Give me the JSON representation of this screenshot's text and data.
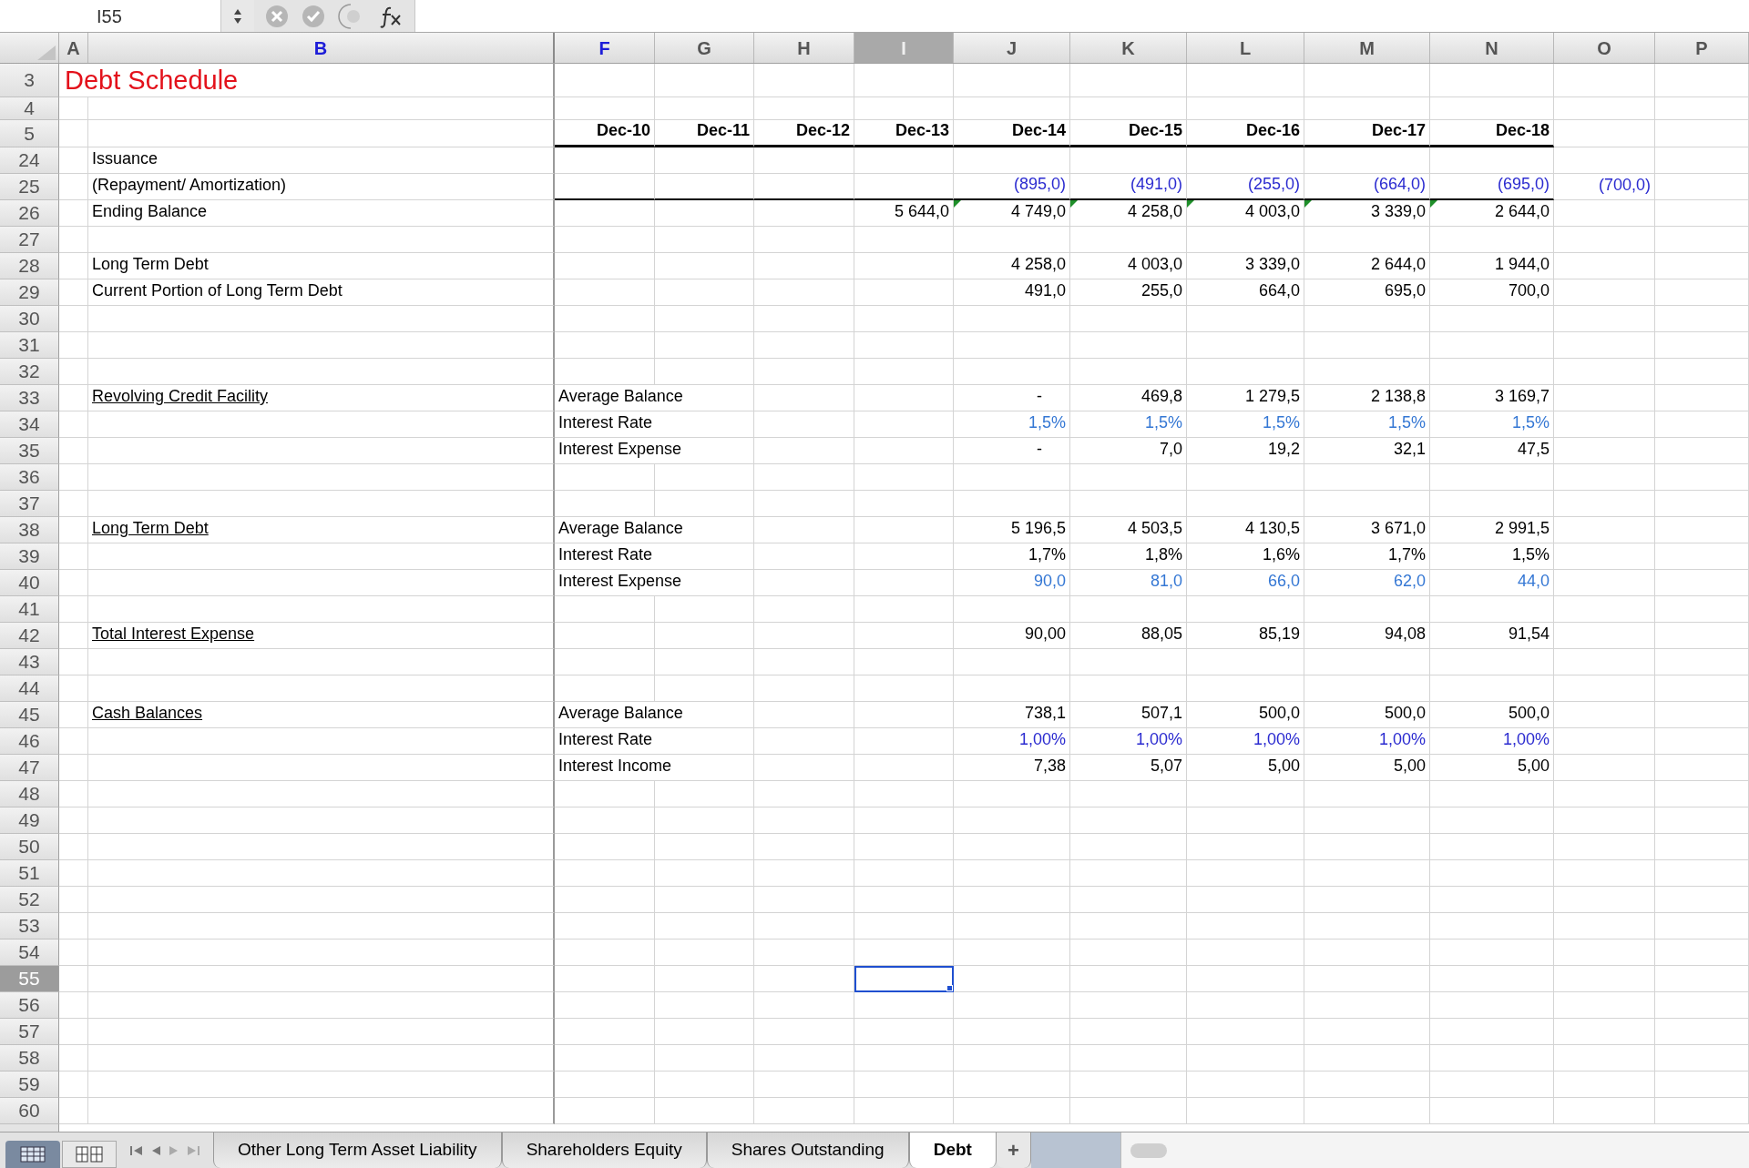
{
  "name_box": {
    "value": "I55"
  },
  "columns": [
    {
      "letter": "A",
      "selected": false,
      "emphasized": false
    },
    {
      "letter": "B",
      "selected": false,
      "emphasized": true
    },
    {
      "letter": "F",
      "selected": false,
      "emphasized": true
    },
    {
      "letter": "G",
      "selected": false,
      "emphasized": false
    },
    {
      "letter": "H",
      "selected": false,
      "emphasized": false
    },
    {
      "letter": "I",
      "selected": true,
      "emphasized": false
    },
    {
      "letter": "J",
      "selected": false,
      "emphasized": false
    },
    {
      "letter": "K",
      "selected": false,
      "emphasized": false
    },
    {
      "letter": "L",
      "selected": false,
      "emphasized": false
    },
    {
      "letter": "M",
      "selected": false,
      "emphasized": false
    },
    {
      "letter": "N",
      "selected": false,
      "emphasized": false
    },
    {
      "letter": "O",
      "selected": false,
      "emphasized": false
    },
    {
      "letter": "P",
      "selected": false,
      "emphasized": false
    }
  ],
  "rows": [
    {
      "number": "3",
      "selected": false,
      "kind": "title",
      "cells": [
        {
          "kind": "title",
          "text": "Debt Schedule"
        }
      ]
    },
    {
      "number": "4",
      "selected": false,
      "kind": "spacer",
      "cells": []
    },
    {
      "number": "5",
      "selected": false,
      "kind": "header",
      "cells": [
        null,
        null,
        {
          "kind": "number",
          "text": "Dec-10"
        },
        {
          "kind": "number",
          "text": "Dec-11"
        },
        {
          "kind": "number",
          "text": "Dec-12"
        },
        {
          "kind": "number",
          "text": "Dec-13"
        },
        {
          "kind": "number",
          "text": "Dec-14"
        },
        {
          "kind": "number",
          "text": "Dec-15"
        },
        {
          "kind": "number",
          "text": "Dec-16"
        },
        {
          "kind": "number",
          "text": "Dec-17"
        },
        {
          "kind": "number",
          "text": "Dec-18"
        }
      ]
    },
    {
      "number": "24",
      "selected": false,
      "kind": "data",
      "cells": [
        null,
        {
          "kind": "text",
          "text": "Issuance"
        }
      ]
    },
    {
      "number": "25",
      "selected": false,
      "kind": "ruled",
      "cells": [
        null,
        {
          "kind": "text",
          "text": "(Repayment/ Amortization)"
        },
        null,
        null,
        null,
        null,
        {
          "kind": "number",
          "text": "(895,0)",
          "color": "#2b2bd0"
        },
        {
          "kind": "number",
          "text": "(491,0)",
          "color": "#2b2bd0"
        },
        {
          "kind": "number",
          "text": "(255,0)",
          "color": "#2b2bd0"
        },
        {
          "kind": "number",
          "text": "(664,0)",
          "color": "#2b2bd0"
        },
        {
          "kind": "number",
          "text": "(695,0)",
          "color": "#2b2bd0"
        },
        {
          "kind": "number",
          "text": "(700,0)",
          "color": "#2b2bd0"
        }
      ]
    },
    {
      "number": "26",
      "selected": false,
      "kind": "data",
      "cells": [
        null,
        {
          "kind": "text",
          "text": "Ending Balance"
        },
        null,
        null,
        null,
        {
          "kind": "number",
          "text": "5 644,0"
        },
        {
          "kind": "number",
          "text": "4 749,0",
          "flag": true
        },
        {
          "kind": "number",
          "text": "4 258,0",
          "flag": true
        },
        {
          "kind": "number",
          "text": "4 003,0",
          "flag": true
        },
        {
          "kind": "number",
          "text": "3 339,0",
          "flag": true
        },
        {
          "kind": "number",
          "text": "2 644,0",
          "flag": true
        }
      ]
    },
    {
      "number": "27",
      "selected": false,
      "kind": "data",
      "cells": []
    },
    {
      "number": "28",
      "selected": false,
      "kind": "data",
      "cells": [
        null,
        {
          "kind": "text",
          "text": "Long Term Debt"
        },
        null,
        null,
        null,
        null,
        {
          "kind": "number",
          "text": "4 258,0"
        },
        {
          "kind": "number",
          "text": "4 003,0"
        },
        {
          "kind": "number",
          "text": "3 339,0"
        },
        {
          "kind": "number",
          "text": "2 644,0"
        },
        {
          "kind": "number",
          "text": "1 944,0"
        }
      ]
    },
    {
      "number": "29",
      "selected": false,
      "kind": "data",
      "cells": [
        null,
        {
          "kind": "text",
          "text": "Current Portion of Long Term Debt"
        },
        null,
        null,
        null,
        null,
        {
          "kind": "number",
          "text": "491,0"
        },
        {
          "kind": "number",
          "text": "255,0"
        },
        {
          "kind": "number",
          "text": "664,0"
        },
        {
          "kind": "number",
          "text": "695,0"
        },
        {
          "kind": "number",
          "text": "700,0"
        }
      ]
    },
    {
      "number": "30",
      "selected": false,
      "kind": "data",
      "cells": []
    },
    {
      "number": "31",
      "selected": false,
      "kind": "data",
      "cells": []
    },
    {
      "number": "32",
      "selected": false,
      "kind": "data",
      "cells": []
    },
    {
      "number": "33",
      "selected": false,
      "kind": "data",
      "cells": [
        null,
        {
          "kind": "text",
          "text": "Revolving Credit Facility",
          "underline": true
        },
        {
          "kind": "text",
          "text": "Average Balance"
        },
        null,
        null,
        null,
        {
          "kind": "dash",
          "text": "-"
        },
        {
          "kind": "number",
          "text": "469,8"
        },
        {
          "kind": "number",
          "text": "1 279,5"
        },
        {
          "kind": "number",
          "text": "2 138,8"
        },
        {
          "kind": "number",
          "text": "3 169,7"
        }
      ]
    },
    {
      "number": "34",
      "selected": false,
      "kind": "data",
      "cells": [
        null,
        null,
        {
          "kind": "text",
          "text": "Interest Rate"
        },
        null,
        null,
        null,
        {
          "kind": "number",
          "text": "1,5%",
          "color": "#3477d4"
        },
        {
          "kind": "number",
          "text": "1,5%",
          "color": "#3477d4"
        },
        {
          "kind": "number",
          "text": "1,5%",
          "color": "#3477d4"
        },
        {
          "kind": "number",
          "text": "1,5%",
          "color": "#3477d4"
        },
        {
          "kind": "number",
          "text": "1,5%",
          "color": "#3477d4"
        }
      ]
    },
    {
      "number": "35",
      "selected": false,
      "kind": "data",
      "cells": [
        null,
        null,
        {
          "kind": "text",
          "text": "Interest Expense"
        },
        null,
        null,
        null,
        {
          "kind": "dash",
          "text": "-"
        },
        {
          "kind": "number",
          "text": "7,0"
        },
        {
          "kind": "number",
          "text": "19,2"
        },
        {
          "kind": "number",
          "text": "32,1"
        },
        {
          "kind": "number",
          "text": "47,5"
        }
      ]
    },
    {
      "number": "36",
      "selected": false,
      "kind": "data",
      "cells": []
    },
    {
      "number": "37",
      "selected": false,
      "kind": "data",
      "cells": []
    },
    {
      "number": "38",
      "selected": false,
      "kind": "data",
      "cells": [
        null,
        {
          "kind": "text",
          "text": "Long Term Debt",
          "underline": true
        },
        {
          "kind": "text",
          "text": "Average Balance"
        },
        null,
        null,
        null,
        {
          "kind": "number",
          "text": "5 196,5"
        },
        {
          "kind": "number",
          "text": "4 503,5"
        },
        {
          "kind": "number",
          "text": "4 130,5"
        },
        {
          "kind": "number",
          "text": "3 671,0"
        },
        {
          "kind": "number",
          "text": "2 991,5"
        }
      ]
    },
    {
      "number": "39",
      "selected": false,
      "kind": "data",
      "cells": [
        null,
        null,
        {
          "kind": "text",
          "text": "Interest Rate"
        },
        null,
        null,
        null,
        {
          "kind": "number",
          "text": "1,7%"
        },
        {
          "kind": "number",
          "text": "1,8%"
        },
        {
          "kind": "number",
          "text": "1,6%"
        },
        {
          "kind": "number",
          "text": "1,7%"
        },
        {
          "kind": "number",
          "text": "1,5%"
        }
      ]
    },
    {
      "number": "40",
      "selected": false,
      "kind": "data",
      "cells": [
        null,
        null,
        {
          "kind": "text",
          "text": "Interest Expense"
        },
        null,
        null,
        null,
        {
          "kind": "number",
          "text": "90,0",
          "color": "#3477d4"
        },
        {
          "kind": "number",
          "text": "81,0",
          "color": "#3477d4"
        },
        {
          "kind": "number",
          "text": "66,0",
          "color": "#3477d4"
        },
        {
          "kind": "number",
          "text": "62,0",
          "color": "#3477d4"
        },
        {
          "kind": "number",
          "text": "44,0",
          "color": "#3477d4"
        }
      ]
    },
    {
      "number": "41",
      "selected": false,
      "kind": "data",
      "cells": []
    },
    {
      "number": "42",
      "selected": false,
      "kind": "data",
      "cells": [
        null,
        {
          "kind": "text",
          "text": "Total Interest Expense",
          "underline": true
        },
        null,
        null,
        null,
        null,
        {
          "kind": "number",
          "text": "90,00"
        },
        {
          "kind": "number",
          "text": "88,05"
        },
        {
          "kind": "number",
          "text": "85,19"
        },
        {
          "kind": "number",
          "text": "94,08"
        },
        {
          "kind": "number",
          "text": "91,54"
        }
      ]
    },
    {
      "number": "43",
      "selected": false,
      "kind": "data",
      "cells": []
    },
    {
      "number": "44",
      "selected": false,
      "kind": "data",
      "cells": []
    },
    {
      "number": "45",
      "selected": false,
      "kind": "data",
      "cells": [
        null,
        {
          "kind": "text",
          "text": "Cash Balances",
          "underline": true
        },
        {
          "kind": "text",
          "text": "Average Balance"
        },
        null,
        null,
        null,
        {
          "kind": "number",
          "text": "738,1"
        },
        {
          "kind": "number",
          "text": "507,1"
        },
        {
          "kind": "number",
          "text": "500,0"
        },
        {
          "kind": "number",
          "text": "500,0"
        },
        {
          "kind": "number",
          "text": "500,0"
        }
      ]
    },
    {
      "number": "46",
      "selected": false,
      "kind": "data",
      "cells": [
        null,
        null,
        {
          "kind": "text",
          "text": "Interest Rate"
        },
        null,
        null,
        null,
        {
          "kind": "number",
          "text": "1,00%",
          "color": "#2b2bd0"
        },
        {
          "kind": "number",
          "text": "1,00%",
          "color": "#2b2bd0"
        },
        {
          "kind": "number",
          "text": "1,00%",
          "color": "#2b2bd0"
        },
        {
          "kind": "number",
          "text": "1,00%",
          "color": "#2b2bd0"
        },
        {
          "kind": "number",
          "text": "1,00%",
          "color": "#2b2bd0"
        }
      ]
    },
    {
      "number": "47",
      "selected": false,
      "kind": "data",
      "cells": [
        null,
        null,
        {
          "kind": "text",
          "text": "Interest Income"
        },
        null,
        null,
        null,
        {
          "kind": "number",
          "text": "7,38"
        },
        {
          "kind": "number",
          "text": "5,07"
        },
        {
          "kind": "number",
          "text": "5,00"
        },
        {
          "kind": "number",
          "text": "5,00"
        },
        {
          "kind": "number",
          "text": "5,00"
        }
      ]
    },
    {
      "number": "48",
      "selected": false,
      "kind": "data",
      "cells": []
    },
    {
      "number": "49",
      "selected": false,
      "kind": "data",
      "cells": []
    },
    {
      "number": "50",
      "selected": false,
      "kind": "data",
      "cells": []
    },
    {
      "number": "51",
      "selected": false,
      "kind": "data",
      "cells": []
    },
    {
      "number": "52",
      "selected": false,
      "kind": "data",
      "cells": []
    },
    {
      "number": "53",
      "selected": false,
      "kind": "data",
      "cells": []
    },
    {
      "number": "54",
      "selected": false,
      "kind": "data",
      "cells": []
    },
    {
      "number": "55",
      "selected": true,
      "kind": "data",
      "cells": []
    },
    {
      "number": "56",
      "selected": false,
      "kind": "data",
      "cells": []
    },
    {
      "number": "57",
      "selected": false,
      "kind": "data",
      "cells": []
    },
    {
      "number": "58",
      "selected": false,
      "kind": "data",
      "cells": []
    },
    {
      "number": "59",
      "selected": false,
      "kind": "data",
      "cells": []
    },
    {
      "number": "60",
      "selected": false,
      "kind": "data",
      "cells": []
    }
  ],
  "sheet_tabs": [
    {
      "label": "Other Long Term Asset Liability",
      "selected": false
    },
    {
      "label": "Shareholders Equity",
      "selected": false
    },
    {
      "label": "Shares Outstanding",
      "selected": false
    },
    {
      "label": "Debt",
      "selected": true
    }
  ],
  "add_sheet": "+"
}
